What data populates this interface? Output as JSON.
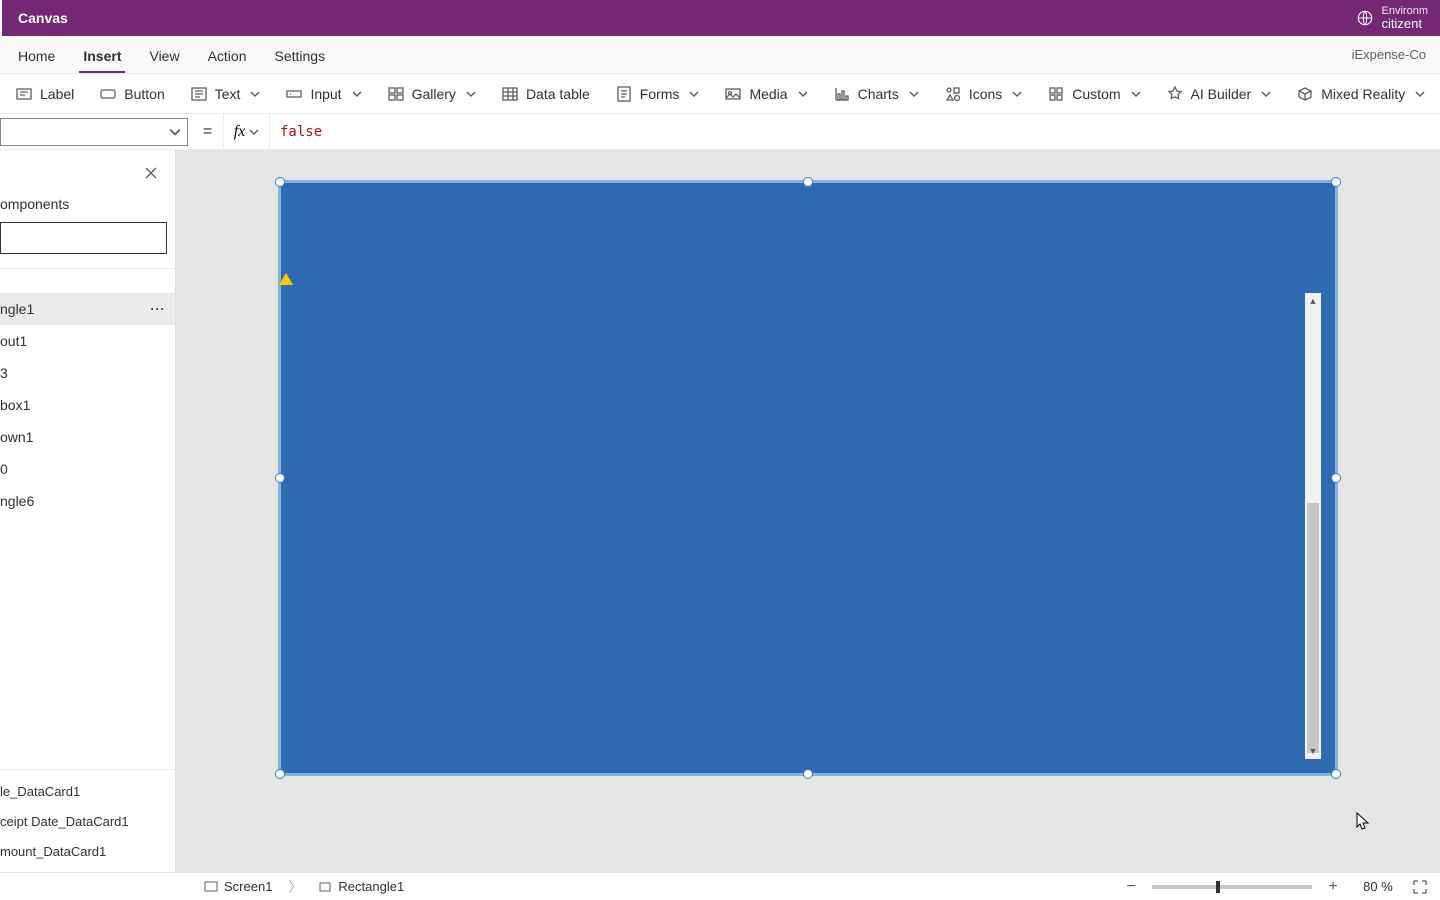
{
  "header": {
    "title": "Canvas",
    "env_label": "Environm",
    "env_value": "citizent"
  },
  "menu": {
    "tabs": [
      "Home",
      "Insert",
      "View",
      "Action",
      "Settings"
    ],
    "active": 1,
    "app_name": "iExpense-Co"
  },
  "ribbon": [
    {
      "id": "label",
      "label": "Label",
      "dd": false
    },
    {
      "id": "button",
      "label": "Button",
      "dd": false
    },
    {
      "id": "text",
      "label": "Text",
      "dd": true
    },
    {
      "id": "input",
      "label": "Input",
      "dd": true
    },
    {
      "id": "gallery",
      "label": "Gallery",
      "dd": true
    },
    {
      "id": "datatable",
      "label": "Data table",
      "dd": false
    },
    {
      "id": "forms",
      "label": "Forms",
      "dd": true
    },
    {
      "id": "media",
      "label": "Media",
      "dd": true
    },
    {
      "id": "charts",
      "label": "Charts",
      "dd": true
    },
    {
      "id": "icons",
      "label": "Icons",
      "dd": true
    },
    {
      "id": "custom",
      "label": "Custom",
      "dd": true
    },
    {
      "id": "aibuilder",
      "label": "AI Builder",
      "dd": true
    },
    {
      "id": "mixedreality",
      "label": "Mixed Reality",
      "dd": true
    }
  ],
  "formula": {
    "property": "",
    "value": "false"
  },
  "tree": {
    "panel_label": "omponents",
    "items": [
      {
        "label": "ngle1",
        "selected": true,
        "more": true
      },
      {
        "label": "out1"
      },
      {
        "label": "3"
      },
      {
        "label": "box1"
      },
      {
        "label": "own1"
      },
      {
        "label": "0"
      },
      {
        "label": "ngle6"
      }
    ],
    "datacards": [
      {
        "label": "le_DataCard1"
      },
      {
        "label": "ceipt Date_DataCard1"
      },
      {
        "label": "mount_DataCard1"
      }
    ]
  },
  "status": {
    "crumbs": [
      {
        "icon": "screen",
        "label": "Screen1"
      },
      {
        "icon": "rect",
        "label": "Rectangle1"
      }
    ],
    "zoom": "80  %"
  }
}
